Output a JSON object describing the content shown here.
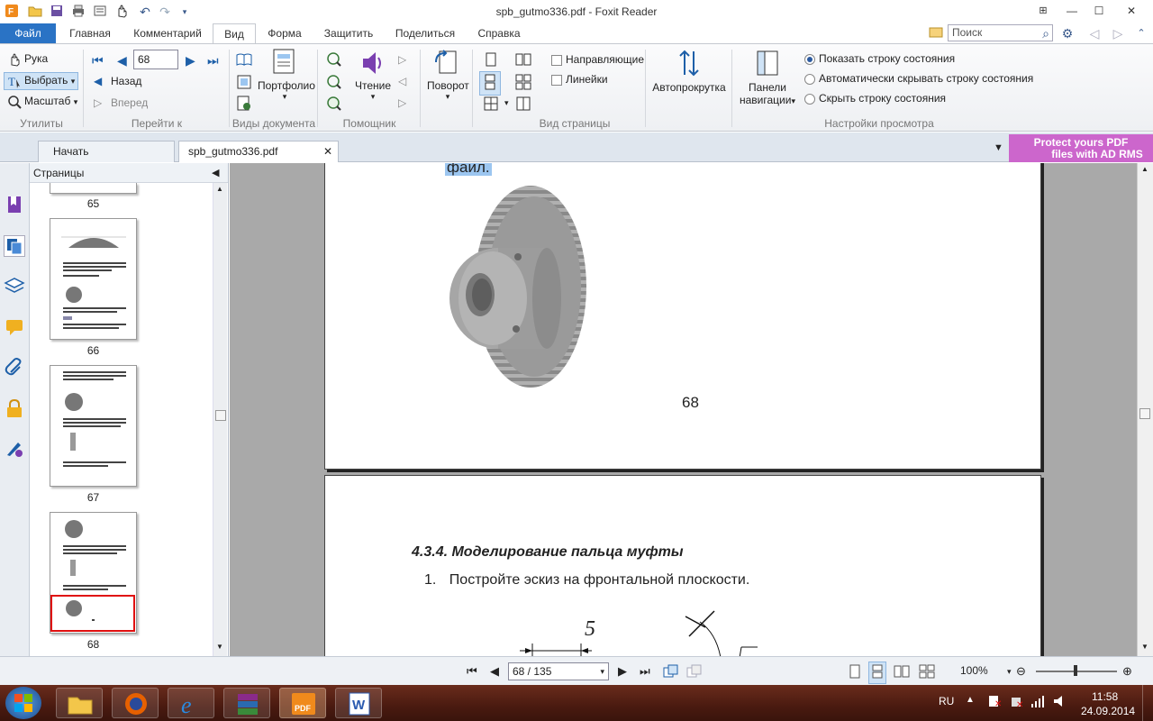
{
  "window": {
    "title": "spb_gutmo336.pdf - Foxit Reader",
    "controls": [
      "minimize",
      "maximize",
      "close"
    ]
  },
  "ribbon_tabs": [
    "Файл",
    "Главная",
    "Комментарий",
    "Вид",
    "Форма",
    "Защитить",
    "Поделиться",
    "Справка"
  ],
  "search": {
    "placeholder": "Поиск"
  },
  "ribbon": {
    "utilities": {
      "hand": "Рука",
      "select": "Выбрать",
      "zoom": "Масштаб",
      "label": "Утилиты"
    },
    "goto": {
      "page_value": "68",
      "back": "Назад",
      "forward": "Вперед",
      "label": "Перейти к"
    },
    "doc_views": {
      "portfolio": "Портфолио",
      "label": "Виды документа"
    },
    "assistant": {
      "reading": "Чтение",
      "label": "Помощник"
    },
    "rotate": {
      "label_btn": "Поворот"
    },
    "page_view": {
      "guides": "Направляющие",
      "rulers": "Линейки",
      "label": "Вид страницы"
    },
    "autoscroll": "Автопрокрутка",
    "nav_panels": {
      "line1": "Панели",
      "line2": "навигации"
    },
    "view_settings": {
      "show_status": "Показать строку состояния",
      "auto_hide": "Автоматически скрывать строку состояния",
      "hide_status": "Скрыть строку состояния",
      "label": "Настройки просмотра"
    }
  },
  "doc_tabs": {
    "start": "Начать",
    "file": "spb_gutmo336.pdf"
  },
  "promo": {
    "line1": "Protect yours PDF",
    "line2": "files with AD RMS"
  },
  "pages_panel": {
    "title": "Страницы",
    "thumbs": [
      "65",
      "66",
      "67",
      "68"
    ],
    "selected": "68"
  },
  "document": {
    "page_a_text": "файл.",
    "page_a_number": "68",
    "section_heading": "4.3.4. Моделирование пальца муфты",
    "list_item_num": "1.",
    "list_item_text": "Постройте эскиз на фронтальной плоскости.",
    "sketch_dim": "5"
  },
  "statusbar": {
    "page_field": "68 / 135",
    "zoom": "100%"
  },
  "taskbar": {
    "lang": "RU",
    "time": "11:58",
    "date": "24.09.2014",
    "apps": [
      "explorer",
      "firefox",
      "internet-explorer",
      "winrar",
      "foxit-pdf",
      "word"
    ]
  },
  "colors": {
    "file_tab": "#2a73c5",
    "taskbar": "#4a1a10",
    "promo": "#cc66cc",
    "highlight": "#9cc6f0"
  }
}
